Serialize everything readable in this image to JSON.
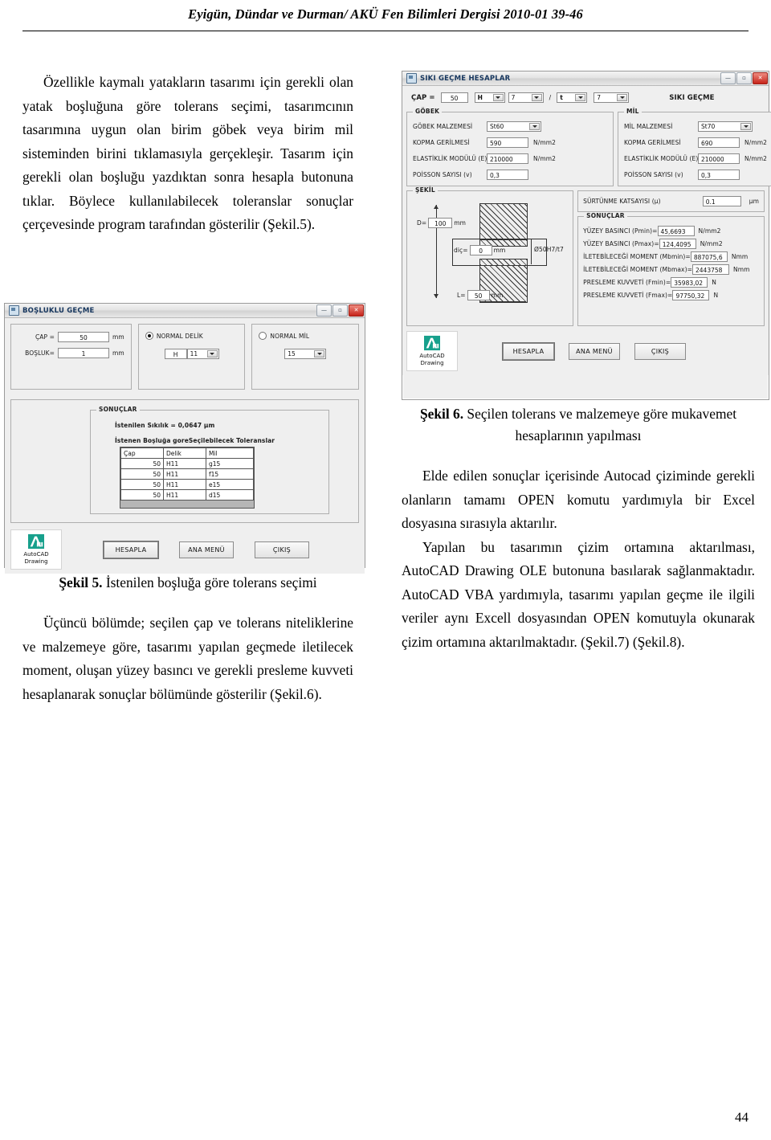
{
  "header": {
    "running_head": "Eyigün, Dündar ve Durman/ AKÜ Fen Bilimleri Dergisi 2010-01 39-46"
  },
  "page_number": "44",
  "left_column": {
    "paragraph_1": "Özellikle kaymalı yatakların tasarımı için gerekli olan yatak boşluğuna göre tolerans seçimi, tasarımcının tasarımına uygun olan birim göbek veya birim mil sisteminden birini tıklamasıyla gerçekleşir. Tasarım için gerekli olan boşluğu yazdıktan sonra hesapla butonuna tıklar. Böylece kullanılabilecek toleranslar sonuçlar çerçevesinde program tarafından gösterilir (Şekil.5).",
    "figure5_caption_label": "Şekil 5.",
    "figure5_caption_text": " İstenilen boşluğa göre tolerans seçimi",
    "paragraph_2": "Üçüncü bölümde; seçilen çap ve tolerans niteliklerine ve malzemeye göre, tasarımı yapılan geçmede iletilecek moment, oluşan yüzey basıncı ve gerekli presleme kuvveti hesaplanarak sonuçlar bölümünde gösterilir (Şekil.6)."
  },
  "right_column": {
    "figure6_caption_label": "Şekil 6.",
    "figure6_caption_text": " Seçilen tolerans ve malzemeye göre mukavemet hesaplarının yapılması",
    "paragraph_1": "Elde edilen sonuçlar içerisinde Autocad çiziminde gerekli olanların tamamı OPEN komutu yardımıyla bir Excel dosyasına sırasıyla aktarılır.",
    "paragraph_2": "Yapılan bu tasarımın çizim ortamına aktarılması, AutoCAD Drawing OLE butonuna basılarak sağlanmaktadır. AutoCAD VBA yardımıyla, tasarımı yapılan geçme ile ilgili veriler aynı Excell dosyasından OPEN komutuyla okunarak çizim ortamına aktarılmaktadır. (Şekil.7) (Şekil.8)."
  },
  "figure5_window": {
    "title": "BOŞLUKLU GEÇME",
    "titlebar_buttons": {
      "minimize": "—",
      "maximize": "▫",
      "close": "✕"
    },
    "cap_label": "ÇAP =",
    "cap_value": "50",
    "cap_unit": "mm",
    "bosluk_label": "BOŞLUK=",
    "bosluk_value": "1",
    "bosluk_unit": "mm",
    "normal_delik_label": "NORMAL DELİK",
    "normal_delik_selected": true,
    "normal_delik_letter": "H",
    "normal_delik_number": "11",
    "normal_mil_label": "NORMAL MİL",
    "normal_mil_selected": false,
    "normal_mil_value": "15",
    "results_legend": "SONUÇLAR",
    "istenilen_sikilik": "İstenilen Sıkılık = 0,0647 µm",
    "table_title": "İstenen Boşluğa goreSeçilebilecek Toleranslar",
    "table_headers": [
      "Çap",
      "Delik",
      "Mil"
    ],
    "table_rows": [
      [
        "50",
        "H11",
        "g15"
      ],
      [
        "50",
        "H11",
        "f15"
      ],
      [
        "50",
        "H11",
        "e15"
      ],
      [
        "50",
        "H11",
        "d15"
      ]
    ],
    "acad_line1": "AutoCAD",
    "acad_line2": "Drawing",
    "buttons": {
      "hesapla": "HESAPLA",
      "ana_menu": "ANA MENÜ",
      "cikis": "ÇIKIŞ"
    }
  },
  "figure6_window": {
    "title": "SIKI GEÇME HESAPLAR",
    "titlebar_buttons": {
      "minimize": "—",
      "maximize": "▫",
      "close": "✕"
    },
    "cap_label": "ÇAP =",
    "cap_value": "50",
    "tol_hole_letter": "H",
    "tol_hole_number": "7",
    "separator": "/",
    "tol_shaft_letter": "t",
    "tol_shaft_number": "7",
    "fit_type": "SIKI GEÇME",
    "gobek": {
      "legend": "GÖBEK",
      "malzeme_label": "GÖBEK MALZEMESİ",
      "malzeme_value": "St60",
      "kopma_label": "KOPMA GERİLMESİ",
      "kopma_value": "590",
      "kopma_unit": "N/mm2",
      "elastik_label": "ELASTİKLİK MODÜLÜ (E)",
      "elastik_value": "210000",
      "elastik_unit": "N/mm2",
      "poisson_label": "POİSSON SAYISI (v)",
      "poisson_value": "0,3"
    },
    "mil": {
      "legend": "MİL",
      "malzeme_label": "MİL MALZEMESİ",
      "malzeme_value": "St70",
      "kopma_label": "KOPMA GERİLMESİ",
      "kopma_value": "690",
      "kopma_unit": "N/mm2",
      "elastik_label": "ELASTİKLİK MODÜLÜ (E)",
      "elastik_value": "210000",
      "elastik_unit": "N/mm2",
      "poisson_label": "POİSSON SAYISI (v)",
      "poisson_value": "0,3"
    },
    "sekil": {
      "legend": "ŞEKİL",
      "d_label": "D=",
      "d_value": "100",
      "d_unit": "mm",
      "dic_label": "diç=",
      "dic_value": "0",
      "dic_unit": "mm",
      "l_label": "L=",
      "l_value": "50",
      "l_unit": "mm",
      "fit_callout": "Ø50H7/t7"
    },
    "surtunme_label": "SÜRTÜNME KATSAYISI (µ)",
    "surtunme_value": "0.1",
    "surtunme_unit": "µm",
    "results": {
      "legend": "SONUÇLAR",
      "rows": [
        {
          "label": "YÜZEY BASINCI (Pmin)=",
          "value": "45,6693",
          "unit": "N/mm2"
        },
        {
          "label": "YÜZEY BASINCI (Pmax)=",
          "value": "124,4095",
          "unit": "N/mm2"
        },
        {
          "label": "İLETEBİLECEĞİ MOMENT (Mbmin)=",
          "value": "887075,6",
          "unit": "Nmm"
        },
        {
          "label": "İLETEBİLECEĞİ MOMENT (Mbmax)=",
          "value": "2443758",
          "unit": "Nmm"
        },
        {
          "label": "PRESLEME KUVVETİ (Fmin)=",
          "value": "35983,02",
          "unit": "N"
        },
        {
          "label": "PRESLEME KUVVETİ (Fmax)=",
          "value": "97750,32",
          "unit": "N"
        }
      ]
    },
    "acad_line1": "AutoCAD",
    "acad_line2": "Drawing",
    "buttons": {
      "hesapla": "HESAPLA",
      "ana_menu": "ANA MENÜ",
      "cikis": "ÇIKIŞ"
    }
  }
}
